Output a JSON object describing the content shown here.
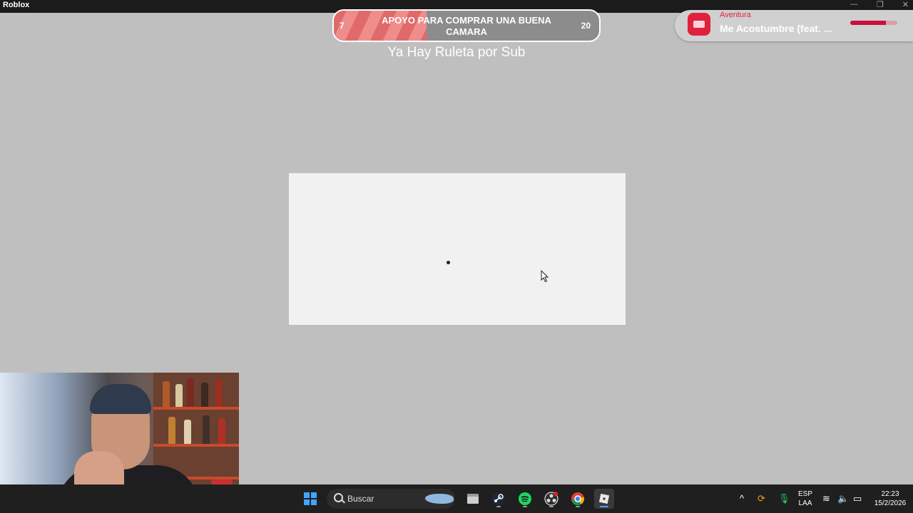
{
  "window": {
    "title": "Roblox",
    "controls": {
      "minimize": "—",
      "restore": "❐",
      "close": "✕"
    }
  },
  "goal": {
    "title": "APOYO PARA COMPRAR UNA BUENA CAMARA",
    "current": "7",
    "target": "20",
    "progress": 0.35,
    "subtitle": "Ya Hay Ruleta por Sub"
  },
  "now_playing": {
    "artist": "Aventura",
    "title": "Me Acostumbre (feat. ...",
    "progress": 0.75,
    "icon": "music-app-icon",
    "accent": "#e0213d"
  },
  "taskbar": {
    "search_placeholder": "Buscar",
    "apps": [
      "windows-start-icon",
      "file-explorer-icon",
      "steam-icon",
      "spotify-icon",
      "obs-icon",
      "chrome-icon",
      "roblox-icon"
    ],
    "lang_line1": "ESP",
    "lang_line2": "LAA",
    "time": "22:23",
    "date": "15/2/2026"
  }
}
